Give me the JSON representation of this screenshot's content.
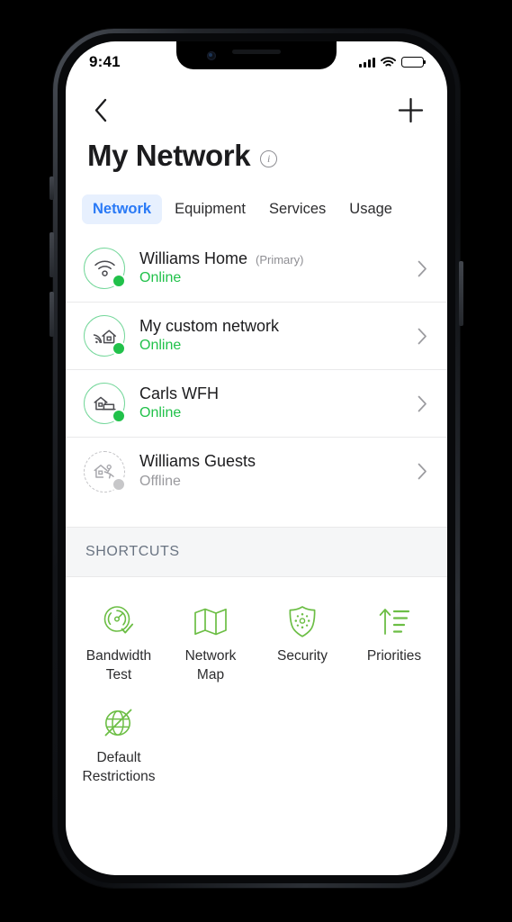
{
  "status_bar": {
    "time": "9:41",
    "signal_icon": "cellular-signal-icon",
    "wifi_icon": "wifi-icon",
    "battery_icon": "battery-icon"
  },
  "nav": {
    "back_icon": "chevron-left-icon",
    "add_icon": "plus-icon"
  },
  "header": {
    "title": "My Network",
    "info_icon": "info-icon",
    "info_glyph": "i"
  },
  "tabs": [
    {
      "label": "Network",
      "active": true
    },
    {
      "label": "Equipment",
      "active": false
    },
    {
      "label": "Services",
      "active": false
    },
    {
      "label": "Usage",
      "active": false
    }
  ],
  "networks": [
    {
      "name": "Williams Home",
      "badge": "(Primary)",
      "status": "Online",
      "online": true,
      "icon": "wifi-signal-icon"
    },
    {
      "name": "My custom network",
      "badge": "",
      "status": "Online",
      "online": true,
      "icon": "home-wifi-icon"
    },
    {
      "name": "Carls WFH",
      "badge": "",
      "status": "Online",
      "online": true,
      "icon": "home-office-icon"
    },
    {
      "name": "Williams Guests",
      "badge": "",
      "status": "Offline",
      "online": false,
      "icon": "home-guest-icon"
    }
  ],
  "shortcuts_section": {
    "title": "SHORTCUTS"
  },
  "shortcuts": [
    {
      "label": "Bandwidth\nTest",
      "label_line1": "Bandwidth",
      "label_line2": "Test",
      "icon": "speedometer-check-icon"
    },
    {
      "label": "Network\nMap",
      "label_line1": "Network",
      "label_line2": "Map",
      "icon": "map-icon"
    },
    {
      "label": "Security",
      "label_line1": "Security",
      "label_line2": "",
      "icon": "shield-icon"
    },
    {
      "label": "Priorities",
      "label_line1": "Priorities",
      "label_line2": "",
      "icon": "priority-arrow-icon"
    },
    {
      "label": "Default\nRestrictions",
      "label_line1": "Default",
      "label_line2": "Restrictions",
      "icon": "globe-blocked-icon"
    }
  ],
  "colors": {
    "accent_green": "#21c14a",
    "icon_green": "#6cbe45",
    "ring_green": "#74d79a",
    "tab_blue": "#2979f6",
    "tab_pill": "#e7f0fe",
    "offline_gray": "#9a9a9e",
    "shortcuts_band": "#f5f6f7"
  }
}
